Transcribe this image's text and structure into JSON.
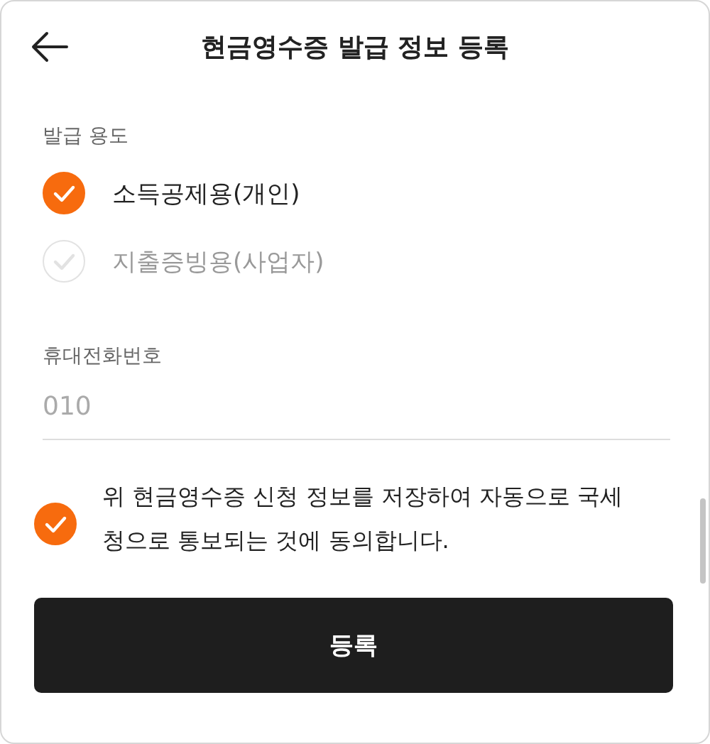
{
  "header": {
    "title": "현금영수증 발급 정보 등록"
  },
  "purpose": {
    "label": "발급 용도",
    "options": [
      {
        "label": "소득공제용(개인)",
        "selected": true
      },
      {
        "label": "지출증빙용(사업자)",
        "selected": false
      }
    ]
  },
  "phone": {
    "label": "휴대전화번호",
    "placeholder": "010"
  },
  "agreement": {
    "text": "위 현금영수증 신청 정보를 저장하여 자동으로 국세청으로 통보되는 것에 동의합니다.",
    "checked": true
  },
  "buttons": [
    "등록"
  ]
}
